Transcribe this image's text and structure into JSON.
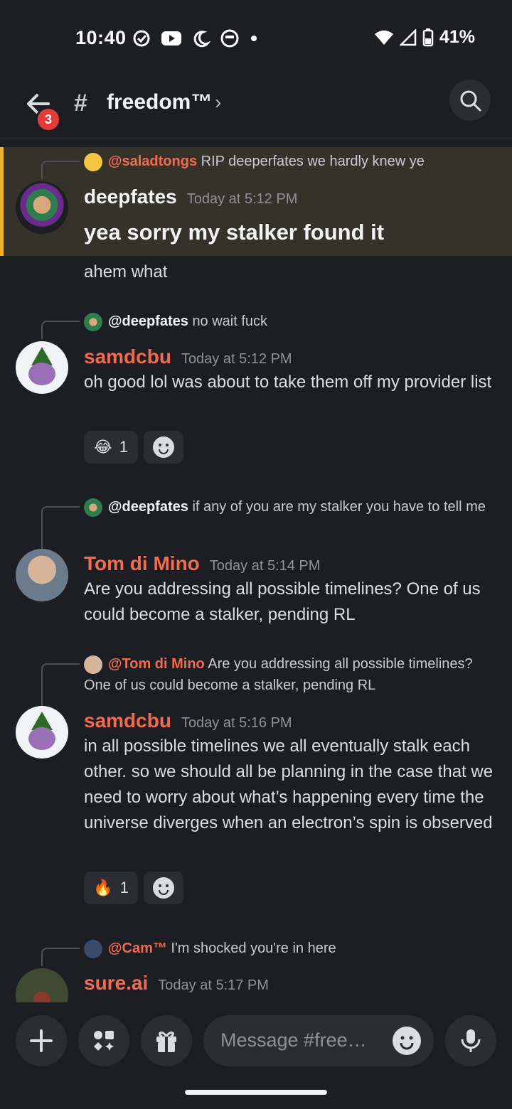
{
  "status": {
    "time": "10:40",
    "battery": "41%"
  },
  "header": {
    "channel": "freedom™",
    "badge": "3"
  },
  "messages": [
    {
      "reply": {
        "name": "@saladtongs",
        "text": "RIP deeperfates we hardly knew ye",
        "name_color": "#f26b4f"
      },
      "author": "deepfates",
      "author_color": "#f2f3f5",
      "time": "Today at 5:12 PM",
      "lines": [
        "yea sorry my stalker found it",
        "ahem what"
      ]
    },
    {
      "reply": {
        "name": "@deepfates",
        "text": "no wait fuck",
        "name_color": "#f2f3f5"
      },
      "author": "samdcbu",
      "author_color": "#f26b4f",
      "time": "Today at 5:12 PM",
      "text": "oh good lol was about to take them off my provider list",
      "reaction": {
        "emoji": "😂",
        "count": "1"
      }
    },
    {
      "reply": {
        "name": "@deepfates",
        "text": "if any of you are my stalker you have to tell me",
        "name_color": "#f2f3f5"
      },
      "author": "Tom di Mino",
      "author_color": "#f26b4f",
      "time": "Today at 5:14 PM",
      "text": "Are you addressing all possible timelines? One of us could become a stalker, pending RL"
    },
    {
      "reply": {
        "name": "@Tom di Mino",
        "text": "Are you addressing all possible timelines? One of us could become a stalker, pending RL",
        "name_color": "#f26b4f"
      },
      "author": "samdcbu",
      "author_color": "#f26b4f",
      "time": "Today at 5:16 PM",
      "text": "in all possible timelines we all eventually stalk each other. so we should all be planning in the case that we need to worry about what’s happening every time the universe diverges when an electron’s spin is observed",
      "reaction": {
        "emoji": "🔥",
        "count": "1"
      }
    },
    {
      "reply": {
        "name": "@Cam™",
        "text": "I'm shocked you're in here",
        "name_color": "#f26b4f"
      },
      "author": "sure.ai",
      "author_color": "#f26b4f",
      "time": "Today at 5:17 PM"
    }
  ],
  "composer": {
    "placeholder": "Message #free…"
  },
  "icons": [
    "back-arrow-icon",
    "search-icon",
    "plus-icon",
    "apps-icon",
    "gift-icon",
    "emoji-icon",
    "mic-icon",
    "wifi-icon",
    "signal-icon",
    "battery-icon"
  ]
}
